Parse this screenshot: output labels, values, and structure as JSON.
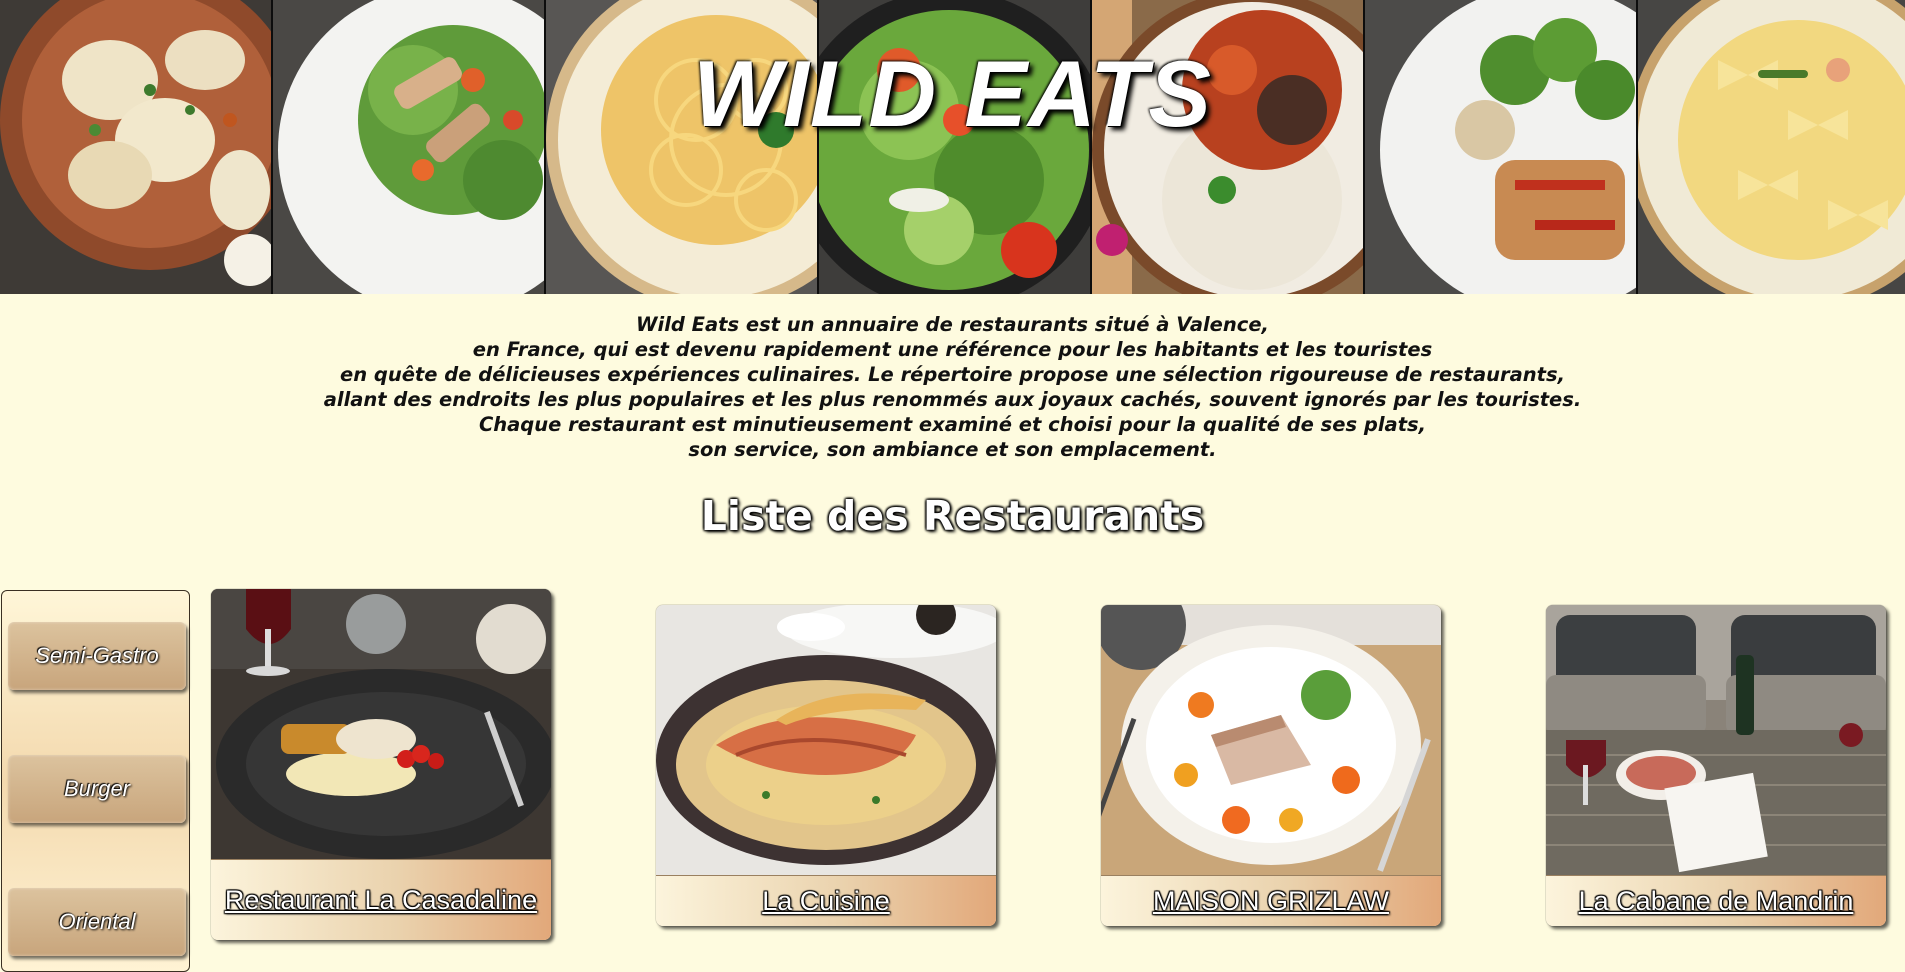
{
  "site": {
    "title": "WILD EATS"
  },
  "banner_photos": [
    {
      "icon": "dumplings-dish-photo"
    },
    {
      "icon": "chicken-salad-photo"
    },
    {
      "icon": "pasta-linguine-photo"
    },
    {
      "icon": "green-salad-photo"
    },
    {
      "icon": "rice-stew-photo"
    },
    {
      "icon": "chicken-broccoli-photo"
    },
    {
      "icon": "farfalle-pasta-photo"
    }
  ],
  "intro": {
    "lines": [
      "Wild Eats est un annuaire de restaurants situé à Valence,",
      "en France, qui est devenu rapidement une référence pour les habitants et les touristes",
      "en quête de délicieuses expériences culinaires. Le répertoire propose une sélection rigoureuse de restaurants,",
      "allant des endroits les plus populaires et les plus renommés aux joyaux cachés, souvent ignorés par les touristes.",
      "Chaque restaurant est minutieusement examiné et choisi pour la qualité de ses plats,",
      "son service, son ambiance et son emplacement."
    ]
  },
  "section": {
    "title": "Liste des Restaurants"
  },
  "categories": [
    {
      "label": "Semi-Gastro"
    },
    {
      "label": "Burger"
    },
    {
      "label": "Oriental"
    }
  ],
  "restaurants": [
    {
      "name": "Restaurant La Casadaline",
      "photo": "plated-dish-wine-photo"
    },
    {
      "name": "La Cuisine",
      "photo": "prawns-plate-photo"
    },
    {
      "name": "MAISON GRIZLAW",
      "photo": "terrine-plate-photo"
    },
    {
      "name": "La Cabane de Mandrin",
      "photo": "terrace-table-photo"
    }
  ],
  "colors": {
    "page_background": "#fefbdf",
    "button_tan": "#c8a57c",
    "caption_peach": "#e2a87a"
  }
}
